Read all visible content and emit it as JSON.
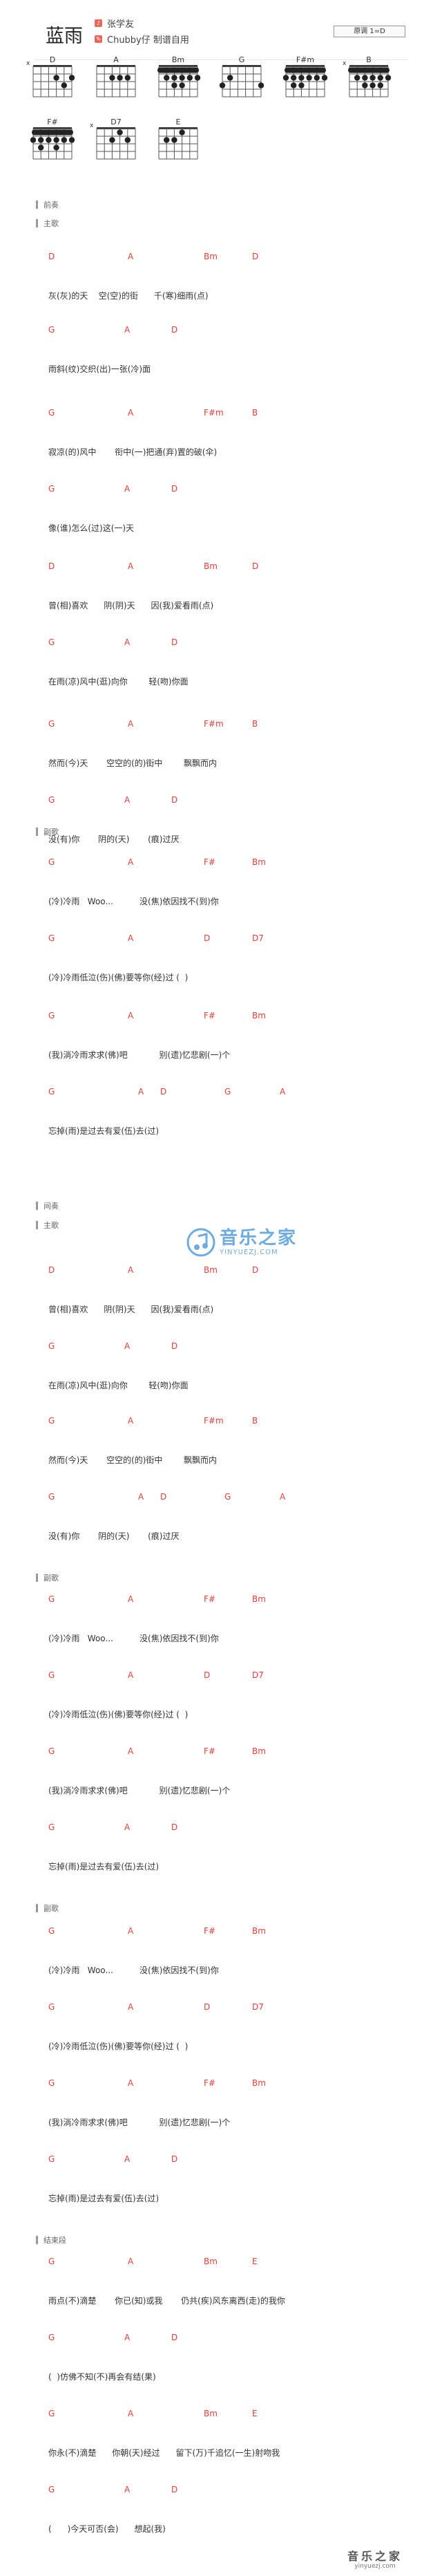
{
  "song": {
    "title": "蓝雨",
    "singer": "张学友",
    "maker": "Chubby仔 制谱自用",
    "key": "原调 1=D"
  },
  "chord_diagrams": [
    {
      "name": "D",
      "mute": "x",
      "barre": false
    },
    {
      "name": "A",
      "mute": "",
      "barre": false
    },
    {
      "name": "Bm",
      "mute": "",
      "barre": true
    },
    {
      "name": "G",
      "mute": "",
      "barre": false
    },
    {
      "name": "F#m",
      "mute": "",
      "barre": true
    },
    {
      "name": "B",
      "mute": "x",
      "barre": true
    },
    {
      "name": "F#",
      "mute": "",
      "barre": true
    },
    {
      "name": "D7",
      "mute": "x",
      "barre": false
    },
    {
      "name": "E",
      "mute": "",
      "barre": false
    }
  ],
  "sections": [
    "前奏",
    "主歌",
    "副歌",
    "间奏",
    "主歌",
    "副歌",
    "副歌",
    "结束段"
  ],
  "lines": [
    {
      "c": [
        "D",
        "A",
        "Bm",
        "D"
      ],
      "l": "灰(灰)的天    空(空)的街      千(寒)细雨(点)"
    },
    {
      "c": [
        "G",
        "A",
        "D"
      ],
      "l": "雨斜(纹)交织(出)一张(冷)面"
    },
    {
      "c": [
        "G",
        "A",
        "F#m",
        "B"
      ],
      "l": "寂凉(的)风中       衔中(一)把通(弃)置的破(伞)"
    },
    {
      "c": [
        "G",
        "A",
        "D"
      ],
      "l": "像(谁)怎么(过)这(一)天"
    },
    {
      "c": [
        "D",
        "A",
        "Bm",
        "D"
      ],
      "l": "曾(相)喜欢      阴(阴)天      因(我)爱看雨(点)"
    },
    {
      "c": [
        "G",
        "A",
        "D"
      ],
      "l": "在雨(凉)风中(逛)向你        轻(吻)你面"
    },
    {
      "c": [
        "G",
        "A",
        "F#m",
        "B"
      ],
      "l": "然而(今)天       空空的(的)街中        飘飘而内"
    },
    {
      "c": [
        "G",
        "A",
        "D"
      ],
      "l": "没(有)你       阴的(天)       (痕)过厌"
    },
    {
      "c": [
        "G",
        "A",
        "F#",
        "Bm"
      ],
      "l": "(冷)冷雨   Woo...          没(焦)依因找不(到)你"
    },
    {
      "c": [
        "G",
        "A",
        "D",
        "D7"
      ],
      "l": "(冷)冷雨低泣(伤)(佛)要等你(经)过 (  )"
    },
    {
      "c": [
        "G",
        "A",
        "F#",
        "Bm"
      ],
      "l": "(我)淌冷雨求求(佛)吧            别(遗)忆悲剧(一)个"
    },
    {
      "c": [
        "G",
        "A",
        "D",
        "G",
        "A"
      ],
      "l": "忘掉(雨)是过去有爱(伍)去(过)"
    },
    {
      "c": [
        "D",
        "A",
        "Bm",
        "D"
      ],
      "l": "曾(相)喜欢      阴(阴)天      因(我)爱看雨(点)"
    },
    {
      "c": [
        "G",
        "A",
        "D"
      ],
      "l": "在雨(凉)风中(逛)向你        轻(吻)你面"
    },
    {
      "c": [
        "G",
        "A",
        "F#m",
        "B"
      ],
      "l": "然而(今)天       空空的(的)街中        飘飘而内"
    },
    {
      "c": [
        "G",
        "A",
        "D",
        "G",
        "A"
      ],
      "l": "没(有)你       阴的(天)       (痕)过厌"
    },
    {
      "c": [
        "G",
        "A",
        "F#",
        "Bm"
      ],
      "l": "(冷)冷雨   Woo...          没(焦)依因找不(到)你"
    },
    {
      "c": [
        "G",
        "A",
        "D",
        "D7"
      ],
      "l": "(冷)冷雨低泣(伤)(佛)要等你(经)过 (  )"
    },
    {
      "c": [
        "G",
        "A",
        "F#",
        "Bm"
      ],
      "l": "(我)淌冷雨求求(佛)吧            别(遗)忆悲剧(一)个"
    },
    {
      "c": [
        "G",
        "A",
        "D"
      ],
      "l": "忘掉(雨)是过去有爱(伍)去(过)"
    },
    {
      "c": [
        "G",
        "A",
        "F#",
        "Bm"
      ],
      "l": "(冷)冷雨   Woo...          没(焦)依因找不(到)你"
    },
    {
      "c": [
        "G",
        "A",
        "D",
        "D7"
      ],
      "l": "(冷)冷雨低泣(伤)(佛)要等你(经)过 (  )"
    },
    {
      "c": [
        "G",
        "A",
        "F#",
        "Bm"
      ],
      "l": "(我)淌冷雨求求(佛)吧            别(遗)忆悲剧(一)个"
    },
    {
      "c": [
        "G",
        "A",
        "D"
      ],
      "l": "忘掉(雨)是过去有爱(伍)去(过)"
    },
    {
      "c": [
        "G",
        "A",
        "Bm",
        "E"
      ],
      "l": "雨点(不)滴楚       你已(知)或我       仍共(疾)风东离西(走)的我你"
    },
    {
      "c": [
        "G",
        "A",
        "D"
      ],
      "l": "(  )仿佛不知(不)再会有结(果)"
    },
    {
      "c": [
        "G",
        "A",
        "Bm",
        "E"
      ],
      "l": "你永(不)滴楚      你朝(天)经过      留下(万)千追忆(一生)射吻我"
    },
    {
      "c": [
        "G",
        "A",
        "D"
      ],
      "l": "(      )今天可否(会)      想起(我)"
    }
  ],
  "watermark": {
    "cn": "音乐之家",
    "en": "YINYUEZJ.COM"
  },
  "footer": {
    "cn": "音乐之家",
    "en": "yinyuezj.com"
  },
  "colors": {
    "chord": "#e0413a",
    "lyric": "#333333",
    "icon": "#e96a5a",
    "watermark": "#3d8fd6"
  }
}
